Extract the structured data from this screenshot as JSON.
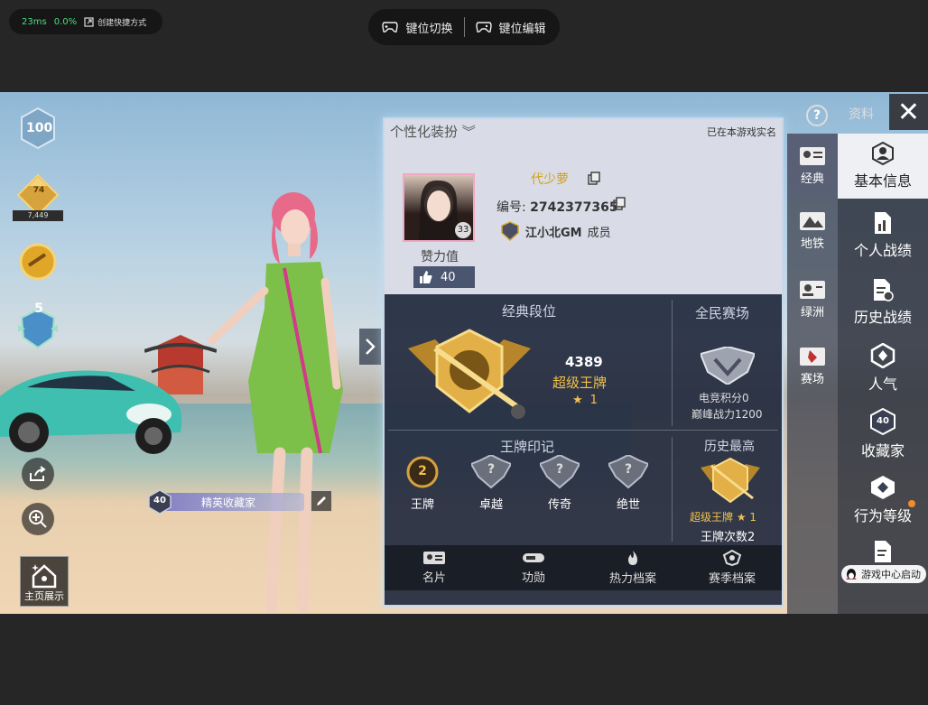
{
  "emulator": {
    "latency": "23ms",
    "loss": "0.0%",
    "shortcut_label": "创建快捷方式",
    "key_switch_label": "键位切换",
    "key_edit_label": "键位编辑"
  },
  "left": {
    "level_badge": "100",
    "tier_badge": "74",
    "tier_points": "7,449",
    "shield_badge": "5",
    "homepage_label": "主页展示",
    "title_level": "40",
    "title_name": "精英收藏家"
  },
  "panel": {
    "custom_tab": "个性化装扮",
    "verified": "已在本游戏实名",
    "player_name": "代少萝",
    "avatar_level": "33",
    "player_id_label": "编号:",
    "player_id": "2742377365",
    "clan_name": "江小北GM",
    "clan_role": "成员",
    "likes_label": "赞力值",
    "likes_value": "40",
    "classic_rank": {
      "title": "经典段位",
      "score": "4389",
      "tier": "超级王牌",
      "stars": "1"
    },
    "arena": {
      "title": "全民赛场",
      "esports_points": "电竞积分0",
      "peak_power": "巅峰战力1200"
    },
    "ace_marks": {
      "title": "王牌印记",
      "items": [
        {
          "label": "王牌",
          "value": "2"
        },
        {
          "label": "卓越",
          "value": "?"
        },
        {
          "label": "传奇",
          "value": "?"
        },
        {
          "label": "绝世",
          "value": "?"
        }
      ]
    },
    "history_best": {
      "title": "历史最高",
      "tier": "超级王牌",
      "stars": "1",
      "count": "王牌次数2"
    },
    "tabs": [
      {
        "label": "名片",
        "icon": "card-icon"
      },
      {
        "label": "功勋",
        "icon": "medal-icon"
      },
      {
        "label": "热力档案",
        "icon": "flame-icon"
      },
      {
        "label": "赛季档案",
        "icon": "season-icon"
      }
    ]
  },
  "right": {
    "profile_label": "资料",
    "modes": [
      {
        "label": "经典",
        "active": true
      },
      {
        "label": "地铁",
        "active": false
      },
      {
        "label": "绿洲",
        "active": false
      },
      {
        "label": "赛场",
        "active": false
      }
    ],
    "nav": [
      {
        "label": "基本信息",
        "active": true
      },
      {
        "label": "个人战绩",
        "active": false
      },
      {
        "label": "历史战绩",
        "active": false
      },
      {
        "label": "人气",
        "active": false
      },
      {
        "label": "收藏家",
        "active": false,
        "badge": "40"
      },
      {
        "label": "行为等级",
        "active": false
      }
    ],
    "game_center": "游戏中心启动"
  },
  "colors": {
    "gold": "#f2c04b",
    "green_stat": "#4ade80",
    "panel_bg": "#222a3e",
    "notify": "#f28c28"
  }
}
